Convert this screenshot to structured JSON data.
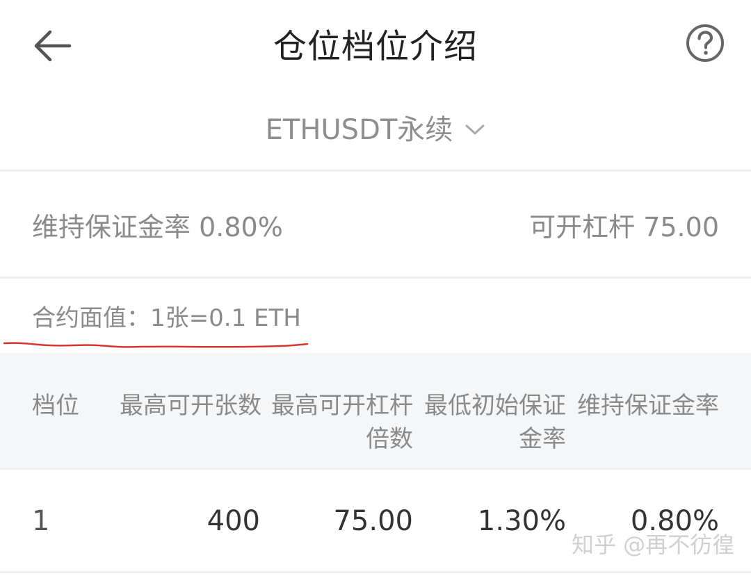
{
  "header": {
    "title": "仓位档位介绍"
  },
  "icons": {
    "back": "back-arrow-icon",
    "help": "question-mark-circle-icon",
    "dropdown": "chevron-down-icon"
  },
  "contract_selector": {
    "label": "ETHUSDT永续"
  },
  "rates": {
    "maintenance_margin_label": "维持保证金率 0.80%",
    "leverage_label": "可开杠杆 75.00"
  },
  "contract_face_value": "合约面值：1张=0.1 ETH",
  "table": {
    "headers": {
      "tier": "档位",
      "max_contracts": "最高可开张数",
      "max_leverage_l1": "最高可开杠杆",
      "max_leverage_l2": "倍数",
      "initial_margin_l1": "最低初始保证",
      "initial_margin_l2": "金率",
      "maintenance_margin": "维持保证金率"
    },
    "rows": [
      {
        "tier": "1",
        "max_contracts": "400",
        "max_leverage": "75.00",
        "initial_margin": "1.30%",
        "maintenance_margin": "0.80%"
      }
    ]
  },
  "watermark": "知乎 @再不彷徨",
  "colors": {
    "annotation_underline": "#d9342b",
    "table_header_bg": "#f5f6f7",
    "divider": "#efefef"
  }
}
